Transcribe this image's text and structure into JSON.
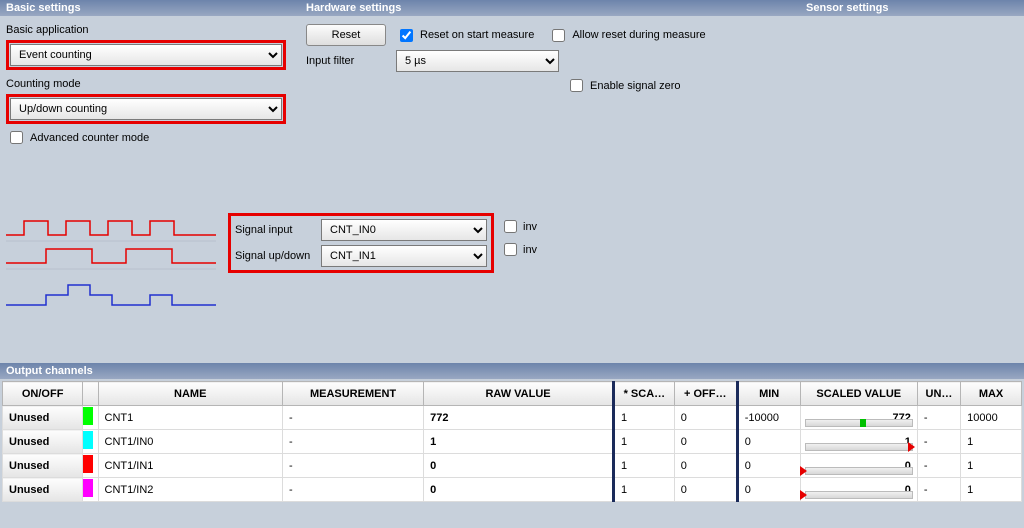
{
  "headers": {
    "basic": "Basic settings",
    "hardware": "Hardware settings",
    "sensor": "Sensor settings",
    "output": "Output channels"
  },
  "basic": {
    "basic_application_label": "Basic application",
    "basic_application_value": "Event counting",
    "counting_mode_label": "Counting mode",
    "counting_mode_value": "Up/down counting",
    "advanced_counter_mode_label": "Advanced counter mode",
    "advanced_counter_mode_checked": false
  },
  "hardware": {
    "reset_button": "Reset",
    "reset_on_start_label": "Reset on start measure",
    "reset_on_start_checked": true,
    "allow_reset_during_label": "Allow reset during measure",
    "allow_reset_during_checked": false,
    "input_filter_label": "Input filter",
    "input_filter_value": "5 µs",
    "enable_signal_zero_label": "Enable signal zero",
    "enable_signal_zero_checked": false
  },
  "signals": {
    "signal_input_label": "Signal input",
    "signal_input_value": "CNT_IN0",
    "signal_updown_label": "Signal up/down",
    "signal_updown_value": "CNT_IN1",
    "inv_label": "inv",
    "inv1_checked": false,
    "inv2_checked": false
  },
  "table": {
    "columns": {
      "onoff": "ON/OFF",
      "color": "",
      "name": "NAME",
      "measurement": "MEASUREMENT",
      "raw": "RAW VALUE",
      "sca": "* SCA…",
      "off": "+ OFF…",
      "min": "MIN",
      "sval": "SCALED VALUE",
      "unit": "UN…",
      "max": "MAX"
    },
    "rows": [
      {
        "onoff": "Unused",
        "color": "c-green",
        "name": "CNT1",
        "measurement": "-",
        "raw": "772",
        "sca": "1",
        "off": "0",
        "min": "-10000",
        "sval": "772",
        "ind_pct": 54,
        "arrow": false,
        "unit": "-",
        "max": "10000"
      },
      {
        "onoff": "Unused",
        "color": "c-cyan",
        "name": "CNT1/IN0",
        "measurement": "-",
        "raw": "1",
        "sca": "1",
        "off": "0",
        "min": "0",
        "sval": "1",
        "ind_pct": 95,
        "arrow": true,
        "unit": "-",
        "max": "1"
      },
      {
        "onoff": "Unused",
        "color": "c-red",
        "name": "CNT1/IN1",
        "measurement": "-",
        "raw": "0",
        "sca": "1",
        "off": "0",
        "min": "0",
        "sval": "0",
        "ind_pct": 2,
        "arrow": true,
        "unit": "-",
        "max": "1"
      },
      {
        "onoff": "Unused",
        "color": "c-magenta",
        "name": "CNT1/IN2",
        "measurement": "-",
        "raw": "0",
        "sca": "1",
        "off": "0",
        "min": "0",
        "sval": "0",
        "ind_pct": 2,
        "arrow": true,
        "unit": "-",
        "max": "1"
      }
    ]
  }
}
